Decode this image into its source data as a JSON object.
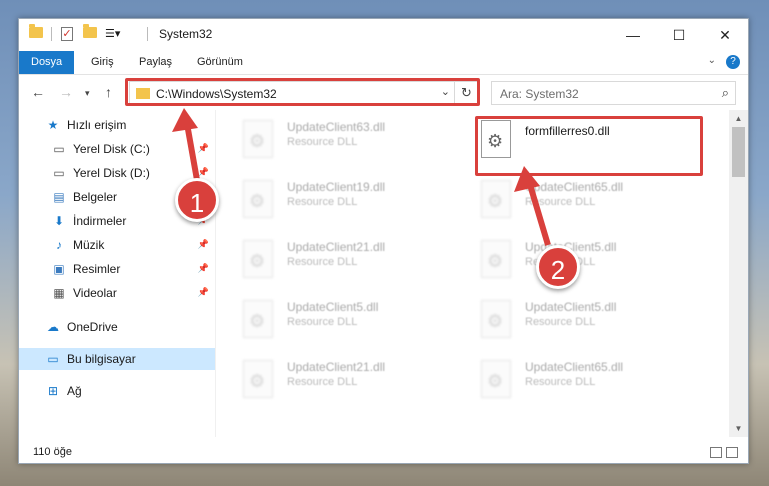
{
  "window": {
    "title": "System32",
    "controls": {
      "minimize": "—",
      "maximize": "☐",
      "close": "✕"
    }
  },
  "ribbon": {
    "tabs": [
      "Dosya",
      "Giriş",
      "Paylaş",
      "Görünüm"
    ]
  },
  "navigation": {
    "address": "C:\\Windows\\System32",
    "search_placeholder": "Ara: System32"
  },
  "sidebar": {
    "items": [
      {
        "label": "Hızlı erişim",
        "icon": "star-icon"
      },
      {
        "label": "Yerel Disk (C:)",
        "icon": "drive-icon"
      },
      {
        "label": "Yerel Disk (D:)",
        "icon": "drive-icon"
      },
      {
        "label": "Belgeler",
        "icon": "documents-icon"
      },
      {
        "label": "İndirmeler",
        "icon": "download-icon"
      },
      {
        "label": "Müzik",
        "icon": "music-icon"
      },
      {
        "label": "Resimler",
        "icon": "pictures-icon"
      },
      {
        "label": "Videolar",
        "icon": "video-icon"
      },
      {
        "label": "OneDrive",
        "icon": "cloud-icon"
      },
      {
        "label": "Bu bilgisayar",
        "icon": "computer-icon"
      },
      {
        "label": "Ağ",
        "icon": "network-icon"
      }
    ]
  },
  "files": [
    {
      "name": "UpdateClient63.dll",
      "desc": "Resource DLL"
    },
    {
      "name": "formfillerres0.dll",
      "desc": ""
    },
    {
      "name": "UpdateClient19.dll",
      "desc": "Resource DLL"
    },
    {
      "name": "UpdateClient65.dll",
      "desc": "Resource DLL"
    },
    {
      "name": "UpdateClient21.dll",
      "desc": "Resource DLL"
    },
    {
      "name": "UpdateClient5.dll",
      "desc": "Resource DLL"
    },
    {
      "name": "UpdateClient5.dll",
      "desc": "Resource DLL"
    },
    {
      "name": "UpdateClient5.dll",
      "desc": "Resource DLL"
    },
    {
      "name": "UpdateClient21.dll",
      "desc": "Resource DLL"
    },
    {
      "name": "UpdateClient65.dll",
      "desc": "Resource DLL"
    }
  ],
  "status": {
    "count": "110 öğe"
  },
  "annotations": {
    "step1": "1",
    "step2": "2",
    "color": "#d9403c"
  }
}
